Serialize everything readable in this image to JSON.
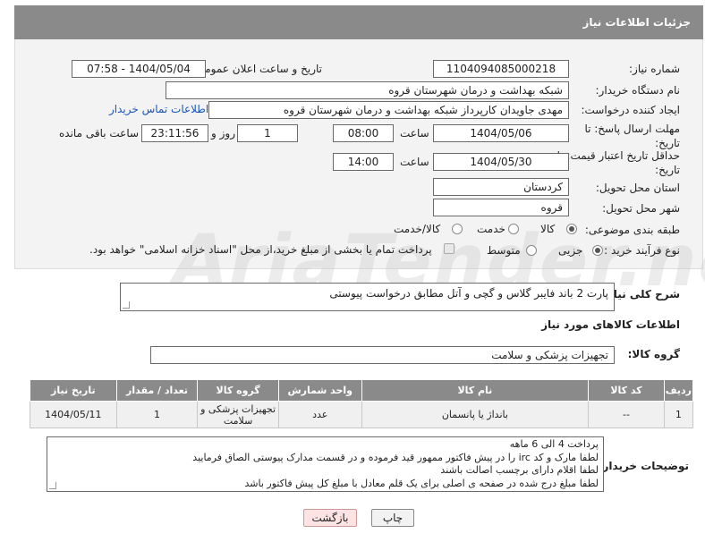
{
  "header": {
    "title": "جزئیات اطلاعات نیاز"
  },
  "fields": {
    "need_number_label": "شماره نیاز:",
    "need_number": "1104094085000218",
    "announce_label": "تاریخ و ساعت اعلان عمومی:",
    "announce_value": "1404/05/04 - 07:58",
    "buyer_org_label": "نام دستگاه خریدار:",
    "buyer_org": "شبکه بهداشت و درمان شهرستان قروه",
    "creator_label": "ایجاد کننده درخواست:",
    "creator": "مهدی جاویدان کارپرداز شبکه بهداشت و درمان شهرستان قروه",
    "contact_link": "اطلاعات تماس خریدار",
    "deadline_label": "مهلت ارسال پاسخ: تا تاریخ:",
    "deadline_date": "1404/05/06",
    "time_label": "ساعت",
    "deadline_time": "08:00",
    "days_value": "1",
    "days_label": "روز و",
    "remaining_time": "23:11:56",
    "remaining_label": "ساعت باقی مانده",
    "validity_label": "حداقل تاریخ اعتبار قیمت: تا تاریخ:",
    "validity_date": "1404/05/30",
    "validity_time": "14:00",
    "province_label": "استان محل تحویل:",
    "province": "کردستان",
    "city_label": "شهر محل تحویل:",
    "city": "قروه",
    "category_label": "طبقه بندی موضوعی:",
    "category_options": [
      "کالا",
      "خدمت",
      "کالا/خدمت"
    ],
    "process_label": "نوع فرآیند خرید :",
    "process_options": [
      "جزیی",
      "متوسط"
    ],
    "payment_note": "پرداخت تمام یا بخشی از مبلغ خرید،از محل \"اسناد خزانه اسلامی\" خواهد بود."
  },
  "description": {
    "label": "شرح کلی نیاز:",
    "value": "پارت 2 باند فایبر گلاس و گچی و آتل مطابق درخواست پیوستی"
  },
  "goods_section": {
    "title": "اطلاعات کالاهای مورد نیاز",
    "group_label": "گروه کالا:",
    "group_value": "تجهیزات پزشکی و سلامت",
    "columns": [
      "ردیف",
      "کد کالا",
      "نام کالا",
      "واحد شمارش",
      "گروه کالا",
      "تعداد / مقدار",
      "تاریخ نیاز"
    ],
    "rows": [
      {
        "row": "1",
        "code": "--",
        "name": "بانداژ یا پانسمان",
        "unit": "عدد",
        "group": "تجهیزات پزشکی و سلامت",
        "qty": "1",
        "date": "1404/05/11"
      }
    ]
  },
  "buyer_notes": {
    "label": "توضیحات خریدار:",
    "lines": [
      "پرداخت 4 الی 6 ماهه",
      "لطفا مارک و کد irc  را در پیش فاکتور ممهور قید فرموده و در قسمت مدارک پیوستی الصاق فرمایید",
      "لطفا اقلام دارای برچسب اصالت باشند",
      "لطفا مبلغ درج شده در صفحه ی اصلی برای یک قلم معادل با مبلغ کل پیش فاکتور باشد"
    ]
  },
  "buttons": {
    "print": "چاپ",
    "back": "بازگشت"
  },
  "watermark": "AriaTender.neT",
  "colors": {
    "header_bg": "#8a8a8a",
    "link": "#1a56b8",
    "back_btn_bg": "#fde3e3"
  }
}
